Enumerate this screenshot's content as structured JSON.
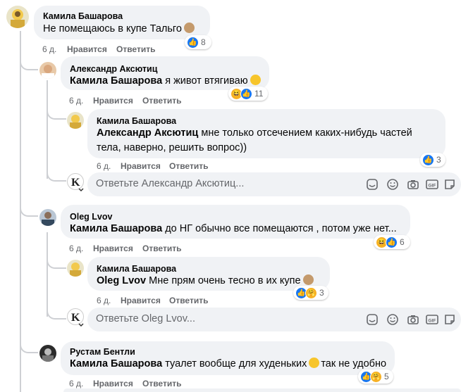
{
  "comments": [
    {
      "author": "Камила Башарова",
      "text": "Не помещаюсь в купе Тальго",
      "time": "6 д.",
      "like_label": "Нравится",
      "reply_label": "Ответить",
      "reactions": [
        "like"
      ],
      "reaction_count": "8"
    },
    {
      "author": "Александр Аксютиц",
      "mention": "Камила Башарова",
      "text": " я живот втягиваю",
      "time": "6 д.",
      "like_label": "Нравится",
      "reply_label": "Ответить",
      "reactions": [
        "haha",
        "like"
      ],
      "reaction_count": "11"
    },
    {
      "author": "Камила Башарова",
      "mention": "Александр Аксютиц",
      "text_line1": " мне только отсечением каких-нибудь частей",
      "text_line2": "тела, наверно, решить вопрос))",
      "time": "6 д.",
      "like_label": "Нравится",
      "reply_label": "Ответить",
      "reactions": [
        "like"
      ],
      "reaction_count": "3"
    },
    {
      "author": "Oleg Lvov",
      "mention": "Камила Башарова",
      "text": " до НГ обычно все помещаются , потом уже нет...",
      "time": "6 д.",
      "like_label": "Нравится",
      "reply_label": "Ответить",
      "reactions": [
        "haha",
        "like"
      ],
      "reaction_count": "6"
    },
    {
      "author": "Камила Башарова",
      "mention": "Oleg Lvov",
      "text": " Мне прям очень тесно в их купе",
      "time": "6 д.",
      "like_label": "Нравится",
      "reply_label": "Ответить",
      "reactions": [
        "like",
        "care"
      ],
      "reaction_count": "3"
    },
    {
      "author": "Рустам Бентли",
      "mention": "Камила Башарова",
      "text_before": " туалет вообще для худеньких",
      "text_after": "так не удобно",
      "time": "6 д.",
      "like_label": "Нравится",
      "reply_label": "Ответить",
      "reactions": [
        "like",
        "care"
      ],
      "reaction_count": "5"
    }
  ],
  "reply_boxes": [
    {
      "placeholder": "Ответьте Александр Аксютиц..."
    },
    {
      "placeholder": "Ответьте Oleg Lvov..."
    }
  ],
  "colors": {
    "bubble": "#f0f2f5",
    "like_blue": "#1877f2",
    "haha_yellow": "#f7b125",
    "meta_gray": "#65676b"
  }
}
